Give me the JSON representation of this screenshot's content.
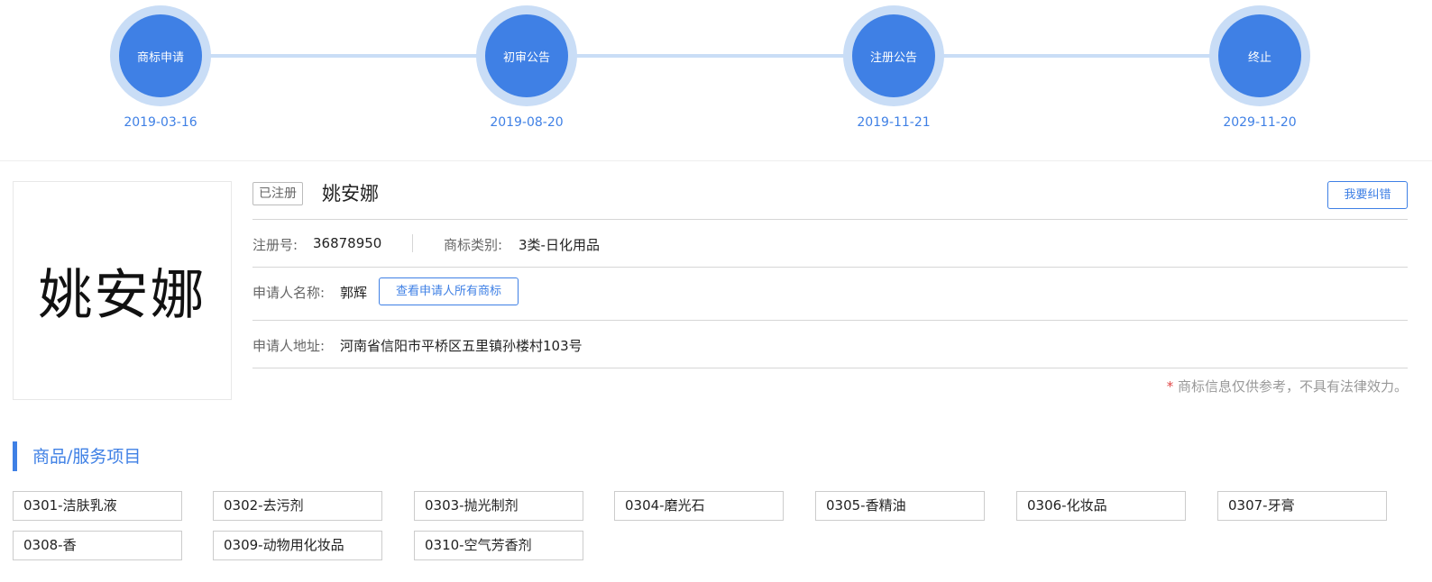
{
  "timeline": [
    {
      "label": "商标申请",
      "date": "2019-03-16"
    },
    {
      "label": "初审公告",
      "date": "2019-08-20"
    },
    {
      "label": "注册公告",
      "date": "2019-11-21"
    },
    {
      "label": "终止",
      "date": "2029-11-20"
    }
  ],
  "trademark": {
    "logo_text": "姚安娜",
    "status": "已注册",
    "name": "姚安娜",
    "correct_button": "我要纠错",
    "reg_no_label": "注册号:",
    "reg_no": "36878950",
    "category_label": "商标类别:",
    "category": "3类-日化用品",
    "applicant_label": "申请人名称:",
    "applicant": "郭辉",
    "view_all_button": "查看申请人所有商标",
    "address_label": "申请人地址:",
    "address": "河南省信阳市平桥区五里镇孙楼村103号",
    "disclaimer_star": "*",
    "disclaimer": "商标信息仅供参考，不具有法律效力。"
  },
  "section": {
    "title": "商品/服务项目"
  },
  "goods": [
    "0301-洁肤乳液",
    "0302-去污剂",
    "0303-抛光制剂",
    "0304-磨光石",
    "0305-香精油",
    "0306-化妆品",
    "0307-牙膏",
    "0308-香",
    "0309-动物用化妆品",
    "0310-空气芳香剂"
  ],
  "colors": {
    "accent": "#3f80e5",
    "ring": "#c9ddf6"
  }
}
